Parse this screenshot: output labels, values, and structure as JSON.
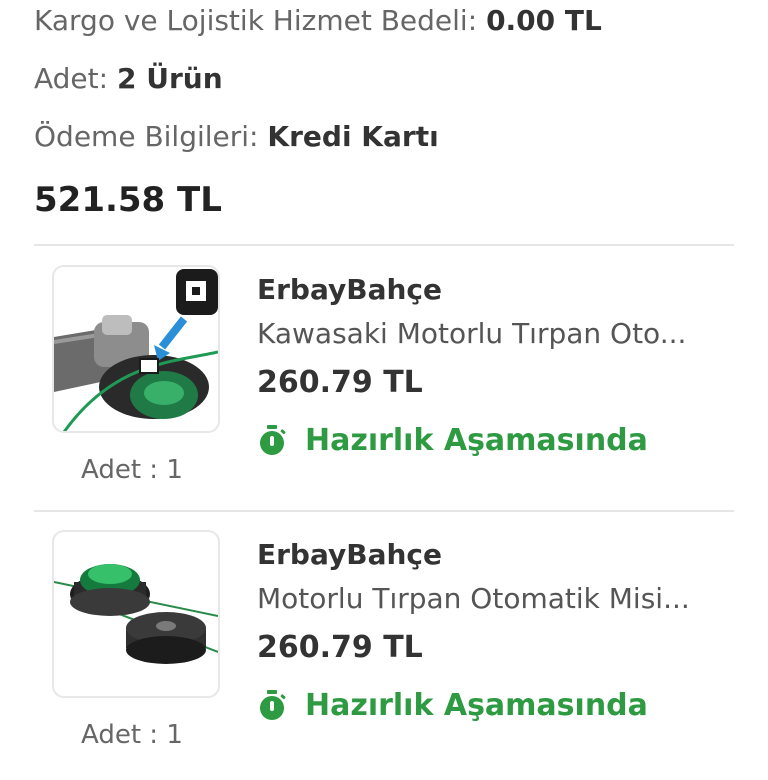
{
  "summary": {
    "shipping_label": "Kargo ve Lojistik Hizmet Bedeli:",
    "shipping_value": "0.00 TL",
    "count_label": "Adet:",
    "count_value": "2 Ürün",
    "payment_label": "Ödeme Bilgileri:",
    "payment_value": "Kredi Kartı",
    "total": "521.58 TL"
  },
  "items": [
    {
      "seller": "ErbayBahçe",
      "title": "Kawasaki Motorlu Tırpan Oto...",
      "price": "260.79 TL",
      "status": "Hazırlık Aşamasında",
      "qty": "Adet : 1",
      "status_icon": "stopwatch-icon"
    },
    {
      "seller": "ErbayBahçe",
      "title": "Motorlu Tırpan Otomatik Misi...",
      "price": "260.79 TL",
      "status": "Hazırlık Aşamasında",
      "qty": "Adet : 1",
      "status_icon": "stopwatch-icon"
    }
  ],
  "colors": {
    "status_green": "#2e9a42",
    "divider": "#e6e6e6"
  }
}
